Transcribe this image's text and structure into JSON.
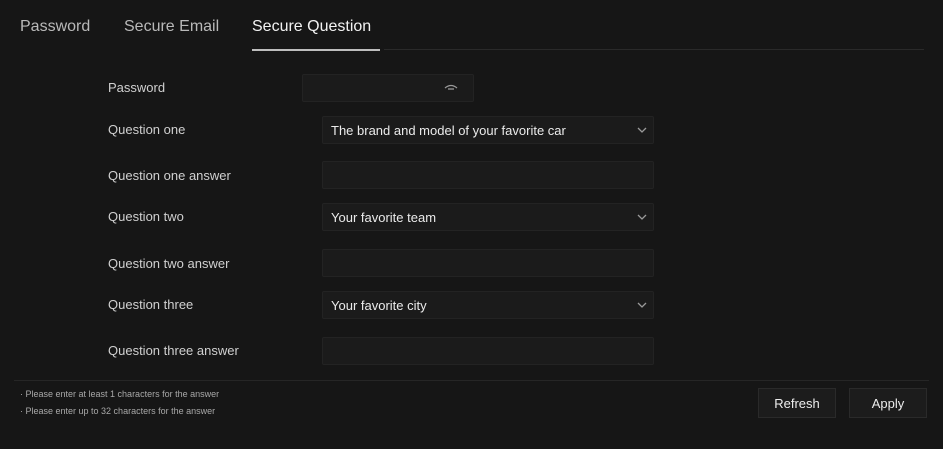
{
  "tabs": [
    {
      "label": "Password"
    },
    {
      "label": "Secure Email"
    },
    {
      "label": "Secure Question"
    }
  ],
  "form": {
    "password_label": "Password",
    "password_value": "",
    "question_one_label": "Question one",
    "question_one_value": "The brand and model of your favorite car",
    "question_one_answer_label": "Question one answer",
    "question_one_answer_value": "",
    "question_two_label": "Question two",
    "question_two_value": "Your favorite team",
    "question_two_answer_label": "Question two answer",
    "question_two_answer_value": "",
    "question_three_label": "Question three",
    "question_three_value": "Your favorite city",
    "question_three_answer_label": "Question three answer",
    "question_three_answer_value": ""
  },
  "notes": [
    "· Please enter at least 1 characters for the answer",
    "· Please enter up to 32 characters for the answer"
  ],
  "buttons": {
    "refresh": "Refresh",
    "apply": "Apply"
  },
  "icons": {
    "eye": "eye-icon",
    "dropdown": "chevron-down-icon"
  },
  "colors": {
    "background": "#161616",
    "field": "#1b1b1b",
    "active_tab_underline": "#bdbdbd"
  }
}
